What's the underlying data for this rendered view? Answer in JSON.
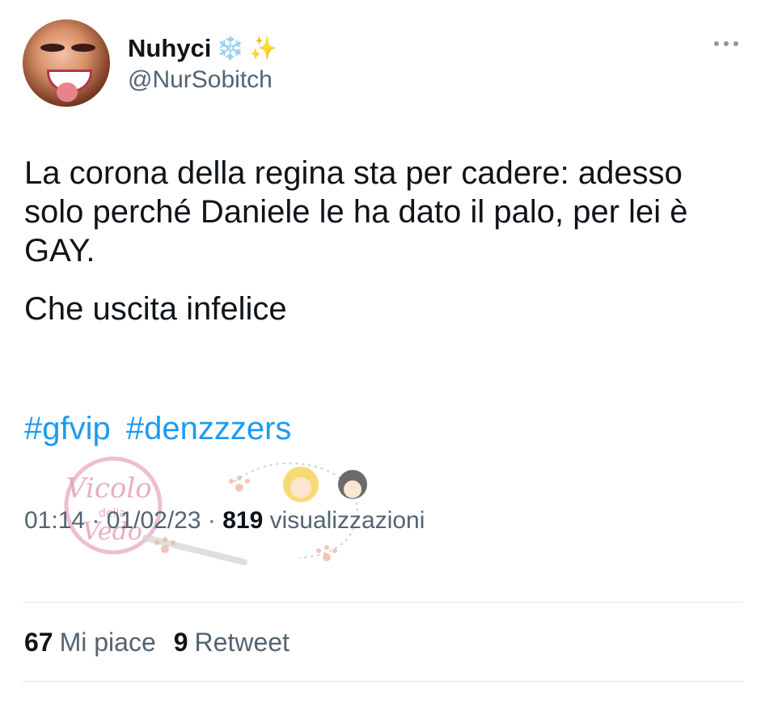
{
  "user": {
    "display_name": "Nuhyci",
    "emoji_1": "❄️",
    "emoji_2": "✨",
    "handle": "@NurSobitch"
  },
  "tweet": {
    "paragraphs": [
      "La corona della regina sta per cadere: adesso solo perché Daniele le ha dato il palo, per lei è GAY.",
      "Che uscita infelice"
    ],
    "hashtags": [
      "#gfvip",
      "#denzzzers"
    ],
    "time": "01:14",
    "date": "01/02/23",
    "separator": "·",
    "views_count": "819",
    "views_label": "visualizzazioni"
  },
  "watermark": {
    "line1": "Vicolo",
    "line2": "della",
    "line3": "Vedo"
  },
  "stats": {
    "likes_count": "67",
    "likes_label": "Mi piace",
    "retweets_count": "9",
    "retweets_label": "Retweet"
  },
  "colors": {
    "link": "#1d9bf0",
    "secondary_text": "#536471",
    "primary_text": "#0f1419"
  }
}
